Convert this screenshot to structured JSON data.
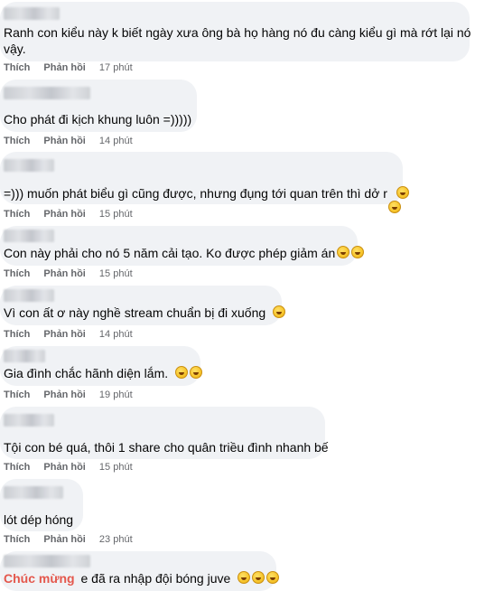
{
  "actions": {
    "like": "Thích",
    "reply": "Phản hồi"
  },
  "comments": [
    {
      "text_lines": [
        "Ranh con kiểu này k biết ngày xưa ông bà họ hàng nó đu càng kiểu gì mà rớt lại nó",
        "vậy."
      ],
      "time": "17 phút",
      "emojis": 0
    },
    {
      "text_lines": [
        "Cho phát đi kịch khung luôn =)))))"
      ],
      "time": "14 phút",
      "emojis": 0
    },
    {
      "text_lines": [
        "=))) muốn phát biểu gì cũng được, nhưng đụng tới quan trên thì dở r"
      ],
      "time": "15 phút",
      "emojis": 2
    },
    {
      "text_lines": [
        "Con này phải cho nó 5 năm cải tạo. Ko được phép giảm án"
      ],
      "time": "15 phút",
      "emojis": 2
    },
    {
      "text_lines": [
        "Vì con ất ơ này nghề stream chuẩn bị đi xuống"
      ],
      "time": "14 phút",
      "emojis": 1
    },
    {
      "text_lines": [
        "Gia đình chắc hãnh diện lắm."
      ],
      "time": "19 phút",
      "emojis": 2
    },
    {
      "text_lines": [
        "Tội con bé quá, thôi 1 share cho quân triều đình nhanh bế"
      ],
      "time": "15 phút",
      "emojis": 0
    },
    {
      "text_lines": [
        "lót dép hóng"
      ],
      "time": "23 phút",
      "emojis": 0
    },
    {
      "highlight": "Chúc mừng",
      "text_lines": [
        "e đã ra nhập đội bóng juve"
      ],
      "time": "",
      "emojis": 3
    }
  ]
}
